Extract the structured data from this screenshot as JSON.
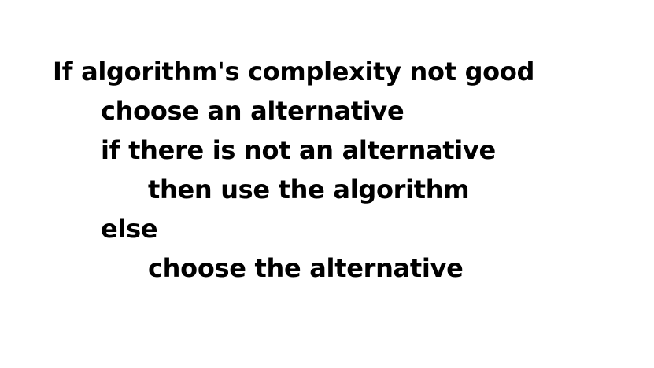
{
  "pseudocode": {
    "lines": [
      "If algorithm's complexity not good",
      "choose an alternative",
      "if there is not an alternative",
      "then use the algorithm",
      "else",
      "choose the alternative"
    ]
  },
  "colors": {
    "text": "#000000",
    "background": "#ffffff"
  }
}
